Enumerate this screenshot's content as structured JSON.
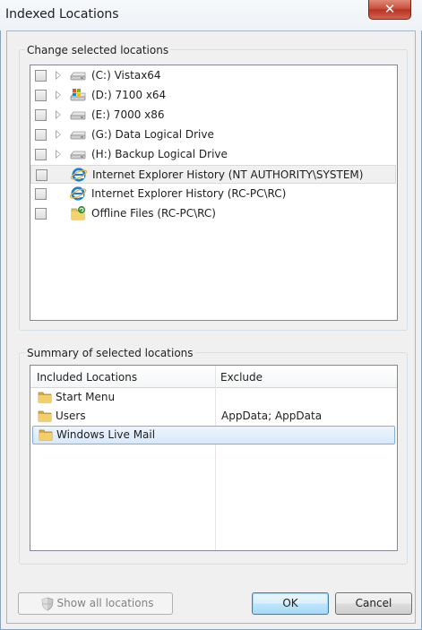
{
  "window": {
    "title": "Indexed Locations",
    "close_glyph": "✕"
  },
  "change_group": {
    "label": "Change selected locations"
  },
  "locations": [
    {
      "label": "(C:) Vistax64",
      "icon": "drive-icon",
      "expandable": true,
      "checked": false
    },
    {
      "label": "(D:) 7100 x64",
      "icon": "windows-drive-icon",
      "expandable": true,
      "checked": false
    },
    {
      "label": "(E:) 7000 x86",
      "icon": "drive-icon",
      "expandable": true,
      "checked": false
    },
    {
      "label": "(G:) Data Logical Drive",
      "icon": "drive-icon",
      "expandable": true,
      "checked": false
    },
    {
      "label": "(H:) Backup Logical Drive",
      "icon": "drive-icon",
      "expandable": true,
      "checked": false
    },
    {
      "label": "Internet Explorer History (NT AUTHORITY\\SYSTEM)",
      "icon": "internet-explorer-icon",
      "expandable": false,
      "checked": false,
      "hover": true
    },
    {
      "label": "Internet Explorer History (RC-PC\\RC)",
      "icon": "internet-explorer-icon",
      "expandable": false,
      "checked": false
    },
    {
      "label": "Offline Files (RC-PC\\RC)",
      "icon": "offline-files-icon",
      "expandable": false,
      "checked": false
    }
  ],
  "summary_group": {
    "label": "Summary of selected locations"
  },
  "summary_table": {
    "columns": [
      "Included Locations",
      "Exclude"
    ],
    "rows": [
      {
        "location": "Start Menu",
        "exclude": ""
      },
      {
        "location": "Users",
        "exclude": "AppData; AppData"
      },
      {
        "location": "Windows Live Mail",
        "exclude": "",
        "selected": true
      }
    ]
  },
  "buttons": {
    "show_all": "Show all locations",
    "ok": "OK",
    "cancel": "Cancel"
  },
  "colors": {
    "accent": "#3c7fb1",
    "selection": "#d7e8fc",
    "close_red": "#c74a35"
  }
}
